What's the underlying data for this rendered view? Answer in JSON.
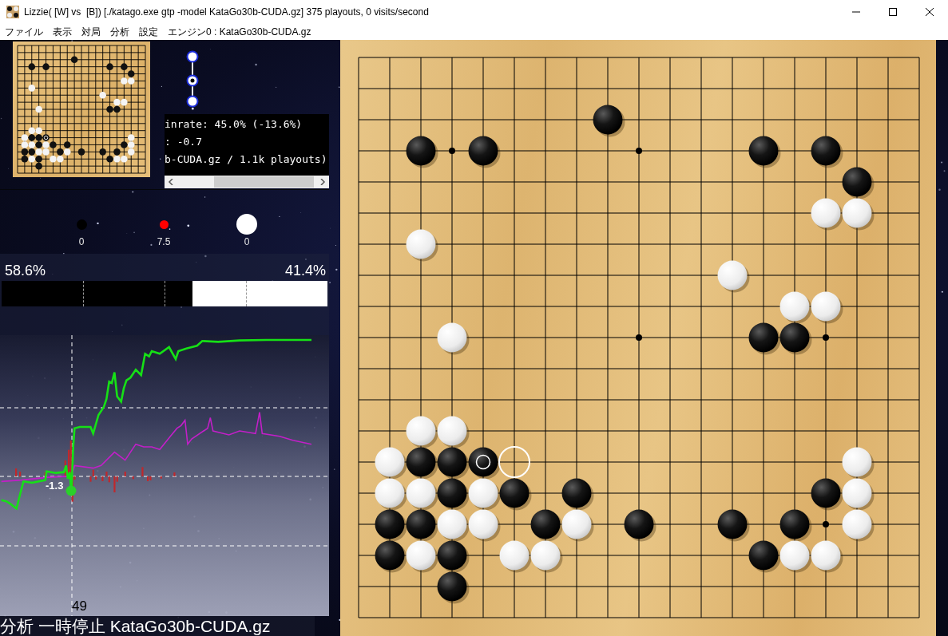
{
  "window": {
    "title": "Lizzie( [W] vs  [B]) [./katago.exe gtp -model KataGo30b-CUDA.gz] 375 playouts, 0 visits/second"
  },
  "menu": [
    {
      "label": "ファイル"
    },
    {
      "label": "表示"
    },
    {
      "label": "対局"
    },
    {
      "label": "分析"
    },
    {
      "label": "設定"
    },
    {
      "label": "エンジン0 : KataGo30b-CUDA.gz"
    }
  ],
  "analysis_info": {
    "lines": [
      "inrate: 45.0% (-13.6%)",
      ": -0.7",
      "b-CUDA.gz / 1.1k playouts)"
    ]
  },
  "captures": [
    {
      "kind": "black",
      "value": "0"
    },
    {
      "kind": "komi",
      "value": "7.5"
    },
    {
      "kind": "white",
      "value": "0"
    }
  ],
  "winrate": {
    "black": "58.6%",
    "white": "41.4%",
    "level": 0.586
  },
  "graph": {
    "score_label": "-1.3",
    "move_number": "49"
  },
  "status": "分析 一時停止 KataGo30b-CUDA.gz",
  "board": {
    "rows": [
      {
        "cells": [
          {
            "kind": "empty"
          },
          {
            "kind": "empty"
          },
          {
            "kind": "empty"
          },
          {
            "kind": "empty"
          },
          {
            "kind": "empty"
          },
          {
            "kind": "empty"
          },
          {
            "kind": "empty"
          },
          {
            "kind": "empty"
          },
          {
            "kind": "empty"
          },
          {
            "kind": "empty"
          },
          {
            "kind": "empty"
          },
          {
            "kind": "empty"
          },
          {
            "kind": "empty"
          },
          {
            "kind": "empty"
          },
          {
            "kind": "empty"
          },
          {
            "kind": "empty"
          },
          {
            "kind": "empty"
          },
          {
            "kind": "empty"
          },
          {
            "kind": "empty"
          }
        ]
      },
      {
        "cells": [
          {
            "kind": "empty"
          },
          {
            "kind": "empty"
          },
          {
            "kind": "empty"
          },
          {
            "kind": "empty"
          },
          {
            "kind": "empty"
          },
          {
            "kind": "empty"
          },
          {
            "kind": "empty"
          },
          {
            "kind": "empty"
          },
          {
            "kind": "empty"
          },
          {
            "kind": "empty"
          },
          {
            "kind": "empty"
          },
          {
            "kind": "empty"
          },
          {
            "kind": "empty"
          },
          {
            "kind": "empty"
          },
          {
            "kind": "empty"
          },
          {
            "kind": "empty"
          },
          {
            "kind": "empty"
          },
          {
            "kind": "empty"
          },
          {
            "kind": "empty"
          }
        ]
      },
      {
        "cells": [
          {
            "kind": "empty"
          },
          {
            "kind": "empty"
          },
          {
            "kind": "empty"
          },
          {
            "kind": "empty"
          },
          {
            "kind": "empty"
          },
          {
            "kind": "empty"
          },
          {
            "kind": "empty"
          },
          {
            "kind": "empty"
          },
          {
            "kind": "black"
          },
          {
            "kind": "empty"
          },
          {
            "kind": "empty"
          },
          {
            "kind": "empty"
          },
          {
            "kind": "empty"
          },
          {
            "kind": "empty"
          },
          {
            "kind": "empty"
          },
          {
            "kind": "empty"
          },
          {
            "kind": "empty"
          },
          {
            "kind": "empty"
          },
          {
            "kind": "empty"
          }
        ]
      },
      {
        "cells": [
          {
            "kind": "empty"
          },
          {
            "kind": "empty"
          },
          {
            "kind": "black"
          },
          {
            "kind": "empty"
          },
          {
            "kind": "black"
          },
          {
            "kind": "empty"
          },
          {
            "kind": "empty"
          },
          {
            "kind": "empty"
          },
          {
            "kind": "empty"
          },
          {
            "kind": "empty"
          },
          {
            "kind": "empty"
          },
          {
            "kind": "empty"
          },
          {
            "kind": "empty"
          },
          {
            "kind": "black"
          },
          {
            "kind": "empty"
          },
          {
            "kind": "black"
          },
          {
            "kind": "empty"
          },
          {
            "kind": "empty"
          },
          {
            "kind": "empty"
          }
        ]
      },
      {
        "cells": [
          {
            "kind": "empty"
          },
          {
            "kind": "empty"
          },
          {
            "kind": "empty"
          },
          {
            "kind": "empty"
          },
          {
            "kind": "empty"
          },
          {
            "kind": "empty"
          },
          {
            "kind": "empty"
          },
          {
            "kind": "empty"
          },
          {
            "kind": "empty"
          },
          {
            "kind": "empty"
          },
          {
            "kind": "empty"
          },
          {
            "kind": "empty"
          },
          {
            "kind": "empty"
          },
          {
            "kind": "empty"
          },
          {
            "kind": "empty"
          },
          {
            "kind": "empty"
          },
          {
            "kind": "black"
          },
          {
            "kind": "empty"
          },
          {
            "kind": "empty"
          }
        ]
      },
      {
        "cells": [
          {
            "kind": "empty"
          },
          {
            "kind": "empty"
          },
          {
            "kind": "empty"
          },
          {
            "kind": "empty"
          },
          {
            "kind": "empty"
          },
          {
            "kind": "empty"
          },
          {
            "kind": "empty"
          },
          {
            "kind": "empty"
          },
          {
            "kind": "empty"
          },
          {
            "kind": "empty"
          },
          {
            "kind": "empty"
          },
          {
            "kind": "empty"
          },
          {
            "kind": "empty"
          },
          {
            "kind": "empty"
          },
          {
            "kind": "empty"
          },
          {
            "kind": "white"
          },
          {
            "kind": "white"
          },
          {
            "kind": "empty"
          },
          {
            "kind": "empty"
          }
        ]
      },
      {
        "cells": [
          {
            "kind": "empty"
          },
          {
            "kind": "empty"
          },
          {
            "kind": "white"
          },
          {
            "kind": "empty"
          },
          {
            "kind": "empty"
          },
          {
            "kind": "empty"
          },
          {
            "kind": "empty"
          },
          {
            "kind": "empty"
          },
          {
            "kind": "empty"
          },
          {
            "kind": "empty"
          },
          {
            "kind": "empty"
          },
          {
            "kind": "empty"
          },
          {
            "kind": "empty"
          },
          {
            "kind": "empty"
          },
          {
            "kind": "empty"
          },
          {
            "kind": "empty"
          },
          {
            "kind": "empty"
          },
          {
            "kind": "empty"
          },
          {
            "kind": "empty"
          }
        ]
      },
      {
        "cells": [
          {
            "kind": "empty"
          },
          {
            "kind": "empty"
          },
          {
            "kind": "empty"
          },
          {
            "kind": "empty"
          },
          {
            "kind": "empty"
          },
          {
            "kind": "empty"
          },
          {
            "kind": "empty"
          },
          {
            "kind": "empty"
          },
          {
            "kind": "empty"
          },
          {
            "kind": "empty"
          },
          {
            "kind": "empty"
          },
          {
            "kind": "empty"
          },
          {
            "kind": "white"
          },
          {
            "kind": "empty"
          },
          {
            "kind": "empty"
          },
          {
            "kind": "empty"
          },
          {
            "kind": "empty"
          },
          {
            "kind": "empty"
          },
          {
            "kind": "empty"
          }
        ]
      },
      {
        "cells": [
          {
            "kind": "empty"
          },
          {
            "kind": "empty"
          },
          {
            "kind": "empty"
          },
          {
            "kind": "empty"
          },
          {
            "kind": "empty"
          },
          {
            "kind": "empty"
          },
          {
            "kind": "empty"
          },
          {
            "kind": "empty"
          },
          {
            "kind": "empty"
          },
          {
            "kind": "empty"
          },
          {
            "kind": "empty"
          },
          {
            "kind": "empty"
          },
          {
            "kind": "empty"
          },
          {
            "kind": "empty"
          },
          {
            "kind": "white"
          },
          {
            "kind": "white"
          },
          {
            "kind": "empty"
          },
          {
            "kind": "empty"
          },
          {
            "kind": "empty"
          }
        ]
      },
      {
        "cells": [
          {
            "kind": "empty"
          },
          {
            "kind": "empty"
          },
          {
            "kind": "empty"
          },
          {
            "kind": "white"
          },
          {
            "kind": "empty"
          },
          {
            "kind": "empty"
          },
          {
            "kind": "empty"
          },
          {
            "kind": "empty"
          },
          {
            "kind": "empty"
          },
          {
            "kind": "empty"
          },
          {
            "kind": "empty"
          },
          {
            "kind": "empty"
          },
          {
            "kind": "empty"
          },
          {
            "kind": "black"
          },
          {
            "kind": "black"
          },
          {
            "kind": "empty"
          },
          {
            "kind": "empty"
          },
          {
            "kind": "empty"
          },
          {
            "kind": "empty"
          }
        ]
      },
      {
        "cells": [
          {
            "kind": "empty"
          },
          {
            "kind": "empty"
          },
          {
            "kind": "empty"
          },
          {
            "kind": "empty"
          },
          {
            "kind": "empty"
          },
          {
            "kind": "empty"
          },
          {
            "kind": "empty"
          },
          {
            "kind": "empty"
          },
          {
            "kind": "empty"
          },
          {
            "kind": "empty"
          },
          {
            "kind": "empty"
          },
          {
            "kind": "empty"
          },
          {
            "kind": "empty"
          },
          {
            "kind": "empty"
          },
          {
            "kind": "empty"
          },
          {
            "kind": "empty"
          },
          {
            "kind": "empty"
          },
          {
            "kind": "empty"
          },
          {
            "kind": "empty"
          }
        ]
      },
      {
        "cells": [
          {
            "kind": "empty"
          },
          {
            "kind": "empty"
          },
          {
            "kind": "empty"
          },
          {
            "kind": "empty"
          },
          {
            "kind": "empty"
          },
          {
            "kind": "empty"
          },
          {
            "kind": "empty"
          },
          {
            "kind": "empty"
          },
          {
            "kind": "empty"
          },
          {
            "kind": "empty"
          },
          {
            "kind": "empty"
          },
          {
            "kind": "empty"
          },
          {
            "kind": "empty"
          },
          {
            "kind": "empty"
          },
          {
            "kind": "empty"
          },
          {
            "kind": "empty"
          },
          {
            "kind": "empty"
          },
          {
            "kind": "empty"
          },
          {
            "kind": "empty"
          }
        ]
      },
      {
        "cells": [
          {
            "kind": "empty"
          },
          {
            "kind": "empty"
          },
          {
            "kind": "white"
          },
          {
            "kind": "white"
          },
          {
            "kind": "empty"
          },
          {
            "kind": "empty"
          },
          {
            "kind": "empty"
          },
          {
            "kind": "empty"
          },
          {
            "kind": "empty"
          },
          {
            "kind": "empty"
          },
          {
            "kind": "empty"
          },
          {
            "kind": "empty"
          },
          {
            "kind": "empty"
          },
          {
            "kind": "empty"
          },
          {
            "kind": "empty"
          },
          {
            "kind": "empty"
          },
          {
            "kind": "empty"
          },
          {
            "kind": "empty"
          },
          {
            "kind": "empty"
          }
        ]
      },
      {
        "cells": [
          {
            "kind": "empty"
          },
          {
            "kind": "white"
          },
          {
            "kind": "black"
          },
          {
            "kind": "black"
          },
          {
            "kind": "black_last_move"
          },
          {
            "kind": "hint"
          },
          {
            "kind": "empty"
          },
          {
            "kind": "empty"
          },
          {
            "kind": "empty"
          },
          {
            "kind": "empty"
          },
          {
            "kind": "empty"
          },
          {
            "kind": "empty"
          },
          {
            "kind": "empty"
          },
          {
            "kind": "empty"
          },
          {
            "kind": "empty"
          },
          {
            "kind": "empty"
          },
          {
            "kind": "white"
          },
          {
            "kind": "empty"
          },
          {
            "kind": "empty"
          }
        ]
      },
      {
        "cells": [
          {
            "kind": "empty"
          },
          {
            "kind": "white"
          },
          {
            "kind": "white"
          },
          {
            "kind": "black"
          },
          {
            "kind": "white"
          },
          {
            "kind": "black"
          },
          {
            "kind": "empty"
          },
          {
            "kind": "black"
          },
          {
            "kind": "empty"
          },
          {
            "kind": "empty"
          },
          {
            "kind": "empty"
          },
          {
            "kind": "empty"
          },
          {
            "kind": "empty"
          },
          {
            "kind": "empty"
          },
          {
            "kind": "empty"
          },
          {
            "kind": "black"
          },
          {
            "kind": "white"
          },
          {
            "kind": "empty"
          },
          {
            "kind": "empty"
          }
        ]
      },
      {
        "cells": [
          {
            "kind": "empty"
          },
          {
            "kind": "black"
          },
          {
            "kind": "black"
          },
          {
            "kind": "white"
          },
          {
            "kind": "white"
          },
          {
            "kind": "empty"
          },
          {
            "kind": "black"
          },
          {
            "kind": "white"
          },
          {
            "kind": "empty"
          },
          {
            "kind": "black"
          },
          {
            "kind": "empty"
          },
          {
            "kind": "empty"
          },
          {
            "kind": "black"
          },
          {
            "kind": "empty"
          },
          {
            "kind": "black"
          },
          {
            "kind": "empty"
          },
          {
            "kind": "white"
          },
          {
            "kind": "empty"
          },
          {
            "kind": "empty"
          }
        ]
      },
      {
        "cells": [
          {
            "kind": "empty"
          },
          {
            "kind": "black"
          },
          {
            "kind": "white"
          },
          {
            "kind": "black"
          },
          {
            "kind": "empty"
          },
          {
            "kind": "white"
          },
          {
            "kind": "white"
          },
          {
            "kind": "empty"
          },
          {
            "kind": "empty"
          },
          {
            "kind": "empty"
          },
          {
            "kind": "empty"
          },
          {
            "kind": "empty"
          },
          {
            "kind": "empty"
          },
          {
            "kind": "black"
          },
          {
            "kind": "white"
          },
          {
            "kind": "white"
          },
          {
            "kind": "empty"
          },
          {
            "kind": "empty"
          },
          {
            "kind": "empty"
          }
        ]
      },
      {
        "cells": [
          {
            "kind": "empty"
          },
          {
            "kind": "empty"
          },
          {
            "kind": "empty"
          },
          {
            "kind": "black"
          },
          {
            "kind": "empty"
          },
          {
            "kind": "empty"
          },
          {
            "kind": "empty"
          },
          {
            "kind": "empty"
          },
          {
            "kind": "empty"
          },
          {
            "kind": "empty"
          },
          {
            "kind": "empty"
          },
          {
            "kind": "empty"
          },
          {
            "kind": "empty"
          },
          {
            "kind": "empty"
          },
          {
            "kind": "empty"
          },
          {
            "kind": "empty"
          },
          {
            "kind": "empty"
          },
          {
            "kind": "empty"
          },
          {
            "kind": "empty"
          }
        ]
      },
      {
        "cells": [
          {
            "kind": "empty"
          },
          {
            "kind": "empty"
          },
          {
            "kind": "empty"
          },
          {
            "kind": "empty"
          },
          {
            "kind": "empty"
          },
          {
            "kind": "empty"
          },
          {
            "kind": "empty"
          },
          {
            "kind": "empty"
          },
          {
            "kind": "empty"
          },
          {
            "kind": "empty"
          },
          {
            "kind": "empty"
          },
          {
            "kind": "empty"
          },
          {
            "kind": "empty"
          },
          {
            "kind": "empty"
          },
          {
            "kind": "empty"
          },
          {
            "kind": "empty"
          },
          {
            "kind": "empty"
          },
          {
            "kind": "empty"
          },
          {
            "kind": "empty"
          }
        ]
      }
    ]
  }
}
